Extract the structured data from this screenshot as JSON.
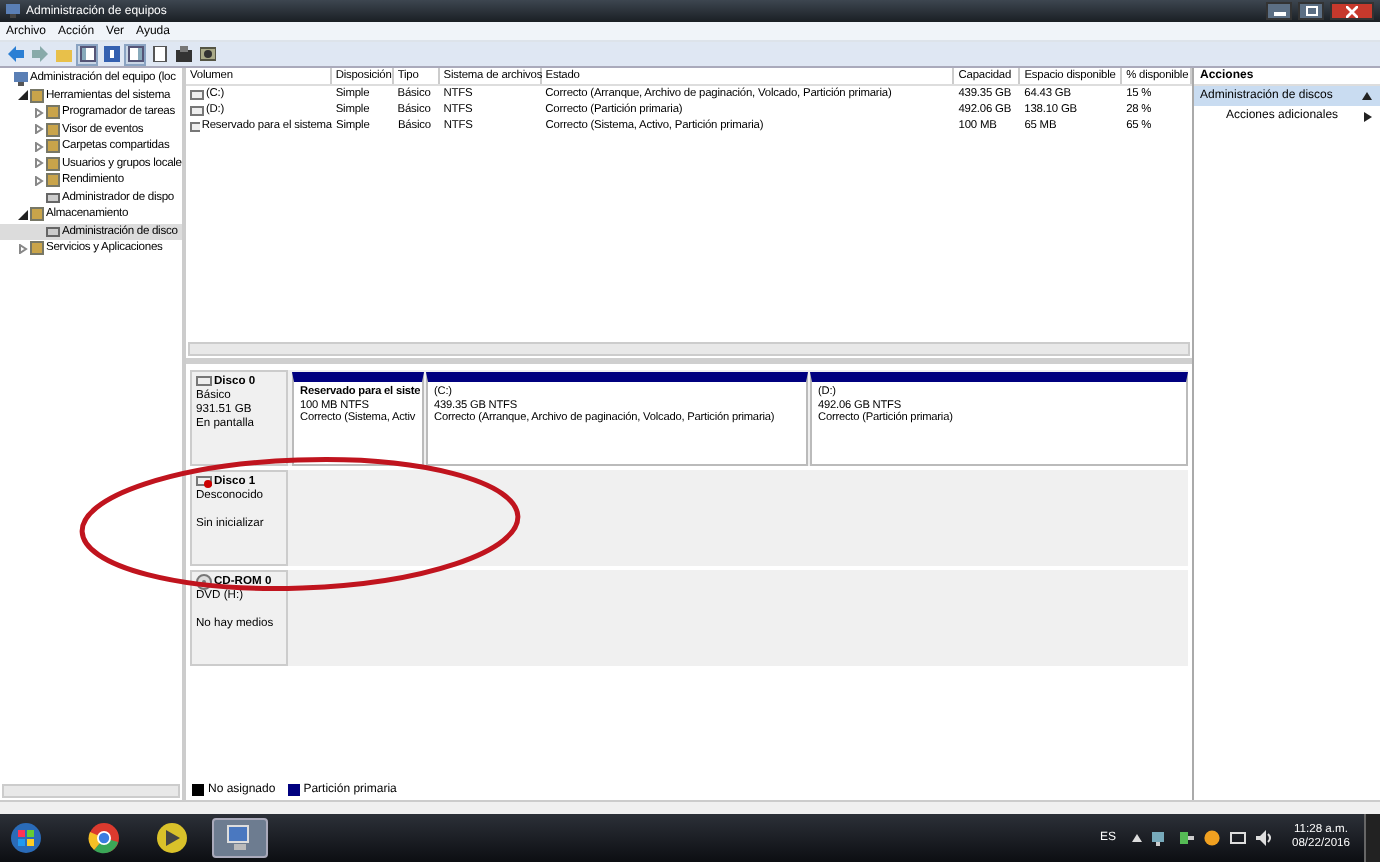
{
  "window": {
    "title": "Administración de equipos"
  },
  "menu": [
    "Archivo",
    "Acción",
    "Ver",
    "Ayuda"
  ],
  "tree": [
    {
      "label": "Administración del equipo (loc",
      "kind": "root",
      "selected": false,
      "children": [
        {
          "label": "Herramientas del sistema",
          "kind": "folder",
          "expanded": true,
          "selected": false,
          "children": [
            {
              "label": "Programador de tareas",
              "kind": "folder",
              "expanded": false,
              "selected": false
            },
            {
              "label": "Visor de eventos",
              "kind": "folder",
              "expanded": false,
              "selected": false
            },
            {
              "label": "Carpetas compartidas",
              "kind": "folder",
              "expanded": false,
              "selected": false
            },
            {
              "label": "Usuarios y grupos locale",
              "kind": "folder",
              "expanded": false,
              "selected": false
            },
            {
              "label": "Rendimiento",
              "kind": "folder",
              "expanded": false,
              "selected": false
            },
            {
              "label": "Administrador de dispo",
              "kind": "leaf",
              "selected": false
            }
          ]
        },
        {
          "label": "Almacenamiento",
          "kind": "folder",
          "expanded": true,
          "selected": false,
          "children": [
            {
              "label": "Administración de disco",
              "kind": "leaf",
              "selected": true
            }
          ]
        },
        {
          "label": "Servicios y Aplicaciones",
          "kind": "folder",
          "expanded": false,
          "selected": false
        }
      ]
    }
  ],
  "volumes": {
    "columns": [
      "Volumen",
      "Disposición",
      "Tipo",
      "Sistema de archivos",
      "Estado",
      "Capacidad",
      "Espacio disponible",
      "% disponible"
    ],
    "rows": [
      [
        "(C:)",
        "Simple",
        "Básico",
        "NTFS",
        "Correcto (Arranque, Archivo de paginación, Volcado, Partición primaria)",
        "439.35 GB",
        "64.43 GB",
        "15 %"
      ],
      [
        "(D:)",
        "Simple",
        "Básico",
        "NTFS",
        "Correcto (Partición primaria)",
        "492.06 GB",
        "138.10 GB",
        "28 %"
      ],
      [
        "Reservado para el sistema",
        "Simple",
        "Básico",
        "NTFS",
        "Correcto (Sistema, Activo, Partición primaria)",
        "100 MB",
        "65 MB",
        "65 %"
      ]
    ]
  },
  "disks": [
    {
      "kind": "disk",
      "name": "Disco 0",
      "type": "Básico",
      "size": "931.51 GB",
      "status": "En pantalla",
      "partitions": [
        {
          "name": "Reservado para el siste",
          "size": "100 MB NTFS",
          "status": "Correcto (Sistema, Activ"
        },
        {
          "name": "(C:)",
          "size": "439.35 GB NTFS",
          "status": "Correcto (Arranque, Archivo de paginación, Volcado, Partición primaria)"
        },
        {
          "name": "(D:)",
          "size": "492.06 GB NTFS",
          "status": "Correcto (Partición primaria)"
        }
      ]
    },
    {
      "kind": "unknown",
      "name": "Disco 1",
      "type": "Desconocido",
      "status": "Sin inicializar"
    },
    {
      "kind": "cdrom",
      "name": "CD-ROM 0",
      "type": "DVD (H:)",
      "status": "No hay medios"
    }
  ],
  "legend": [
    {
      "label": "No asignado",
      "color": "#000000"
    },
    {
      "label": "Partición primaria",
      "color": "#00007f"
    }
  ],
  "actions": {
    "title": "Acciones",
    "items": [
      {
        "label": "Administración de discos",
        "kind": "section",
        "selected": true
      },
      {
        "label": "Acciones adicionales",
        "kind": "submenu",
        "selected": false
      }
    ]
  },
  "taskbar": {
    "apps": [
      {
        "kind": "browser",
        "active": false
      },
      {
        "kind": "media",
        "active": false
      },
      {
        "kind": "computer",
        "active": true
      }
    ],
    "language": "ES",
    "time": "11:28 a.m.",
    "date": "08/22/2016"
  }
}
